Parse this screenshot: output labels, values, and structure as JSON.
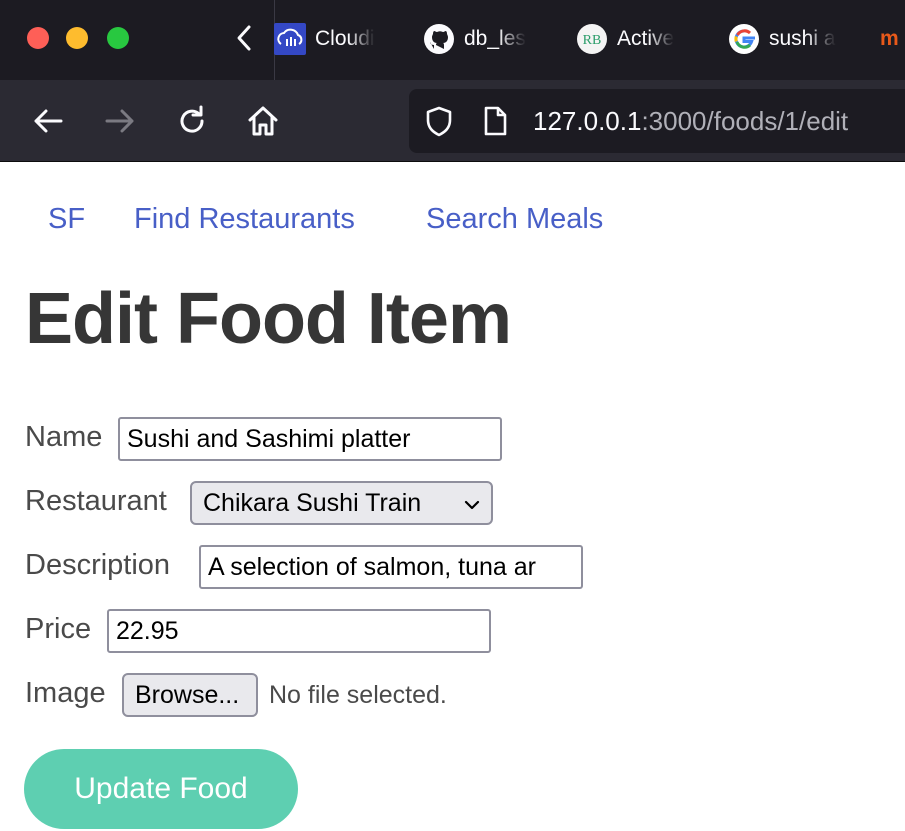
{
  "browser": {
    "tabs": [
      {
        "label": "Cloudi",
        "icon": "cloudinary-icon"
      },
      {
        "label": "db_les",
        "icon": "github-icon"
      },
      {
        "label": "Active",
        "icon": "rb-icon",
        "icon_text": "RB"
      },
      {
        "label": "sushi a",
        "icon": "google-icon"
      },
      {
        "label": "m",
        "icon": ""
      }
    ],
    "url": {
      "host": "127.0.0.1",
      "path": ":3000/foods/1/edit"
    }
  },
  "nav": {
    "brand": "SF",
    "links": [
      "Find Restaurants",
      "Search Meals"
    ]
  },
  "page_title": "Edit Food Item",
  "form": {
    "name_label": "Name",
    "name_value": "Sushi and Sashimi platter",
    "restaurant_label": "Restaurant",
    "restaurant_selected": "Chikara Sushi Train",
    "description_label": "Description",
    "description_value": "A selection of salmon, tuna ar",
    "price_label": "Price",
    "price_value": "22.95",
    "image_label": "Image",
    "browse_label": "Browse...",
    "file_status": "No file selected.",
    "submit_label": "Update Food"
  },
  "colors": {
    "link": "#485fc7",
    "submit": "#5ecfb1",
    "tabbar_bg": "#1c1b22",
    "toolbar_bg": "#2b2a33"
  }
}
